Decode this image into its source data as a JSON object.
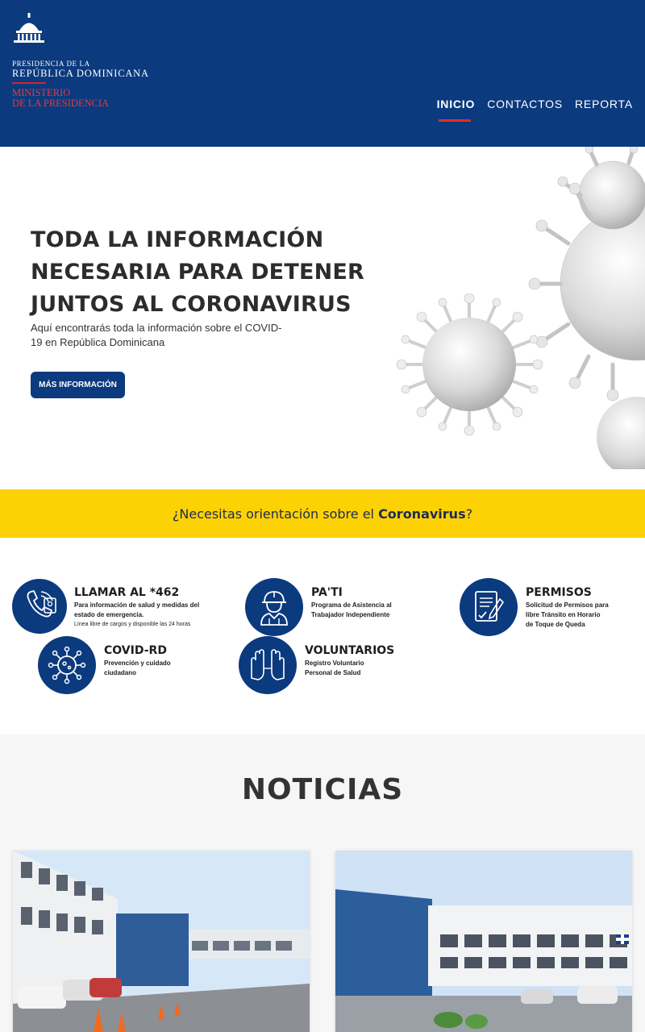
{
  "header": {
    "logo": {
      "line1": "PRESIDENCIA DE LA",
      "line2": "REPÚBLICA DOMINICANA",
      "ministerio1": "MINISTERIO",
      "ministerio2": "DE LA PRESIDENCIA",
      "icon": "national-palace-dome"
    },
    "nav": [
      {
        "label": "INICIO",
        "active": true
      },
      {
        "label": "CONTACTOS",
        "active": false
      },
      {
        "label": "REPORTA",
        "active": false
      }
    ],
    "colors": {
      "background": "#0b3a7e",
      "active_underline": "#e22b2b"
    }
  },
  "hero": {
    "title": "TODA LA INFORMACIÓN NECESARIA PARA DETENER JUNTOS AL CORONAVIRUS",
    "subtitle": "Aquí encontrarás toda la información sobre el COVID-19 en República Dominicana",
    "button_label": "MÁS INFORMACIÓN",
    "image": "coronavirus-particles"
  },
  "banner": {
    "text_prefix": "¿Necesitas orientación sobre el ",
    "text_strong": "Coronavirus",
    "text_suffix": "?",
    "color": "#fcd205"
  },
  "services": [
    {
      "title": "LLAMAR AL *462",
      "desc_line1": "Para información de salud y medidas del",
      "desc_line2": "estado de emergencia.",
      "note": "Línea libre de cargos y disponible las 24 horas",
      "icon": "phone-call-icon"
    },
    {
      "title": "PA'TI",
      "desc_line1": "Programa de Asistencia al",
      "desc_line2": "Trabajador Independiente",
      "icon": "worker-icon"
    },
    {
      "title": "PERMISOS",
      "desc_line1": "Solicitud de Permisos para",
      "desc_line2": "libre Tránsito en Horario",
      "desc_line3": "de Toque de Queda",
      "icon": "document-signature-icon"
    },
    {
      "title": "COVID-RD",
      "desc_line1": "Prevención y cuidado",
      "desc_line2": "ciudadano",
      "icon": "virus-icon"
    },
    {
      "title": "VOLUNTARIOS",
      "desc_line1": "Registro Voluntario",
      "desc_line2": "Personal de Salud",
      "icon": "raised-hands-icon"
    }
  ],
  "news": {
    "title": "NOTICIAS",
    "cards": [
      {
        "image": "ministerio-salud-publica-building-entrance"
      },
      {
        "image": "ministerio-salud-publica-building-facade"
      }
    ]
  }
}
